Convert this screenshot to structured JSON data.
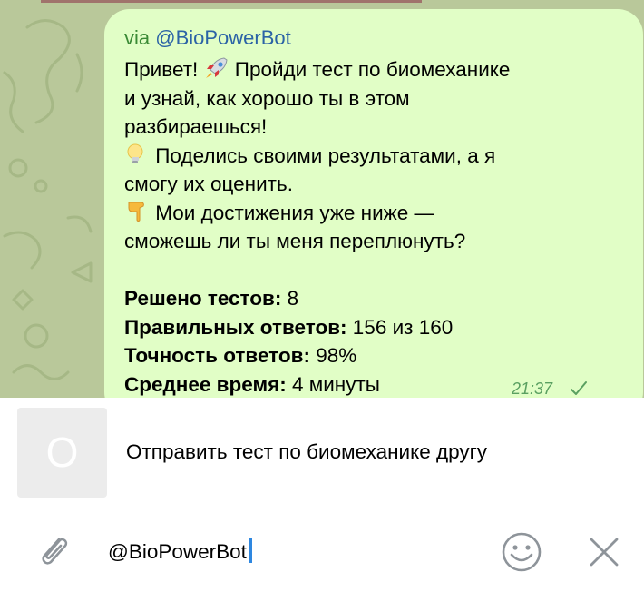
{
  "message": {
    "via_prefix": "via",
    "via_bot": "@BioPowerBot",
    "lines": [
      {
        "before": "Привет! ",
        "emoji": "rocket",
        "after": " Пройди тест по биомеханике"
      },
      {
        "text": "и узнай, как хорошо ты в этом"
      },
      {
        "text": "разбираешься!"
      },
      {
        "emoji": "lightbulb",
        "after": " Поделись своими результатами, а я"
      },
      {
        "text": "смогу их оценить."
      },
      {
        "emoji": "pointing-down",
        "after": " Мои достижения уже ниже —"
      },
      {
        "text": "сможешь ли ты меня переплюнуть?"
      }
    ],
    "stats": [
      {
        "label": "Решено тестов:",
        "value": " 8"
      },
      {
        "label": "Правильных ответов:",
        "value": " 156 из 160"
      },
      {
        "label": "Точность ответов:",
        "value": " 98%"
      },
      {
        "label": "Среднее время:",
        "value": " 4 минуты"
      }
    ],
    "time": "21:37",
    "status_icon": "check-icon"
  },
  "inline_result": {
    "thumb_letter": "O",
    "title": "Отправить тест по биомеханике другу"
  },
  "input": {
    "value": "@BioPowerBot",
    "icons": [
      "paperclip-icon",
      "emoji-icon",
      "close-icon"
    ]
  },
  "colors": {
    "bubble": "#e1fec6",
    "via": "#3a8a35",
    "bot_link": "#2b63a6",
    "time": "#5aa061",
    "caret": "#2e87e0",
    "chat_background": "#b9c89a"
  }
}
